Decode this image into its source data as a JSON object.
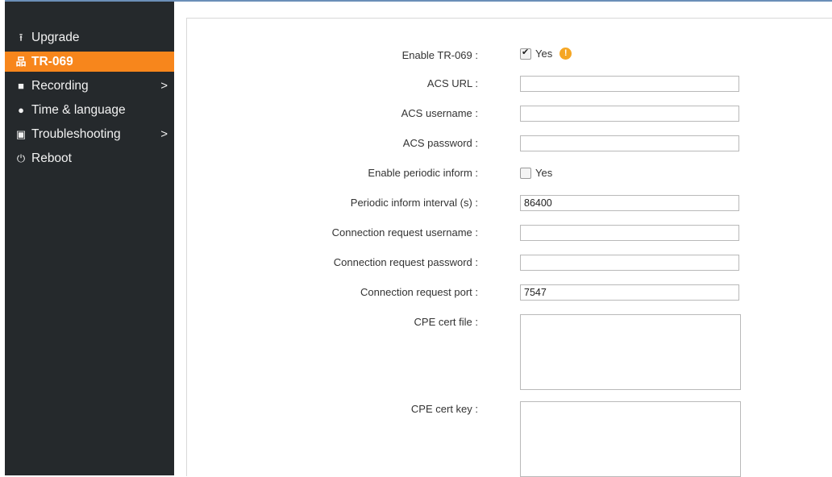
{
  "sidebar": {
    "items": [
      {
        "label": "Upgrade",
        "icon": "upload-icon",
        "glyph": "⭱",
        "active": false,
        "has_submenu": false
      },
      {
        "label": "TR-069",
        "icon": "network-icon",
        "glyph": "品",
        "active": true,
        "has_submenu": false
      },
      {
        "label": "Recording",
        "icon": "video-camera-icon",
        "glyph": "■",
        "active": false,
        "has_submenu": true
      },
      {
        "label": "Time & language",
        "icon": "language-icon",
        "glyph": "●",
        "active": false,
        "has_submenu": false
      },
      {
        "label": "Troubleshooting",
        "icon": "toolbox-icon",
        "glyph": "▣",
        "active": false,
        "has_submenu": true
      },
      {
        "label": "Reboot",
        "icon": "power-icon",
        "glyph": "⏻",
        "active": false,
        "has_submenu": false
      }
    ],
    "submenu_chevron": ">",
    "accent_color": "#f7861c",
    "background_color": "#25292c"
  },
  "form": {
    "enable_tr069": {
      "label": "Enable TR-069 :",
      "checked": true,
      "option": "Yes",
      "info_icon": "warning-icon"
    },
    "acs_url": {
      "label": "ACS URL :",
      "value": ""
    },
    "acs_username": {
      "label": "ACS username :",
      "value": ""
    },
    "acs_password": {
      "label": "ACS password :",
      "value": ""
    },
    "enable_periodic_inform": {
      "label": "Enable periodic inform :",
      "checked": false,
      "option": "Yes"
    },
    "periodic_inform_interval": {
      "label": "Periodic inform interval (s) :",
      "value": "86400"
    },
    "connection_request_username": {
      "label": "Connection request username :",
      "value": ""
    },
    "connection_request_password": {
      "label": "Connection request password :",
      "value": ""
    },
    "connection_request_port": {
      "label": "Connection request port :",
      "value": "7547"
    },
    "cpe_cert_file": {
      "label": "CPE cert file :",
      "value": ""
    },
    "cpe_cert_key": {
      "label": "CPE cert key :",
      "value": ""
    }
  }
}
